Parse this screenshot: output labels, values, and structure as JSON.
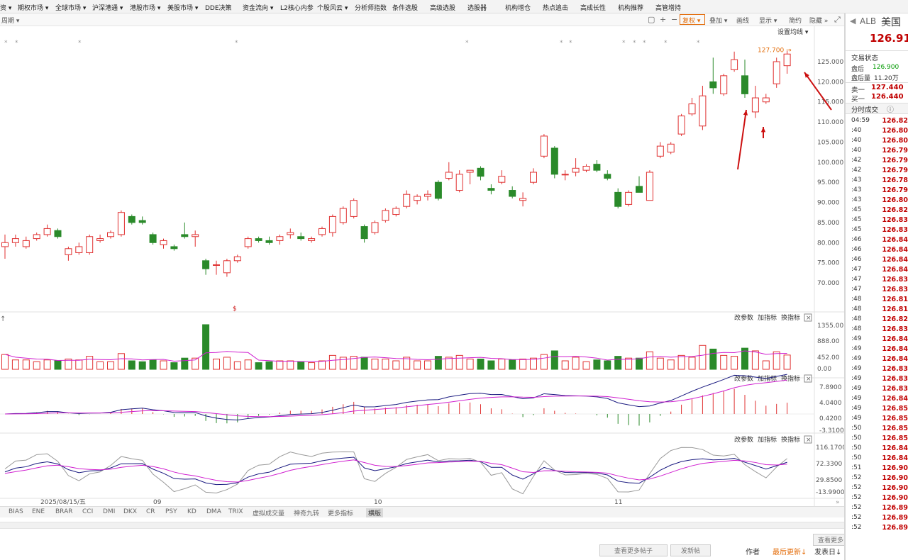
{
  "top_nav": [
    "资 ▾",
    "期权市场 ▾",
    "全球市场 ▾",
    "沪深港通 ▾",
    "港股市场 ▾",
    "美股市场 ▾",
    "DDE决策",
    "资金流向 ▾",
    "L2核心内参",
    "个股风云 ▾",
    "分析师指数",
    "条件选股",
    "高级选股",
    "选股器",
    "机构增仓",
    "热点追击",
    "高成长性",
    "机构推荐",
    "高管增持"
  ],
  "toolbar": {
    "period": "周期 ▾",
    "icons": [
      "□",
      "+",
      "−"
    ],
    "fuquan": "复权 ▾",
    "overlay": "叠加 ▾",
    "draw": "画线",
    "display": "显示 ▾",
    "simple": "简约",
    "hide": "隐藏 »",
    "ma_setting": "设置均线 ▾"
  },
  "panel_buttons": [
    "改参数",
    "加指标",
    "换指标"
  ],
  "symbol": {
    "code": "ALB",
    "market": "美国",
    "price": "126.910"
  },
  "trade_status": {
    "title": "交易状态",
    "after_label": "盘后",
    "after_value": "126.900",
    "after_vol_label": "盘后量",
    "after_vol_value": "11.20万",
    "ask_label": "卖一",
    "ask_value": "127.440",
    "bid_label": "买一",
    "bid_value": "126.440"
  },
  "tick_title": "分时成交",
  "ticks": [
    {
      "t": "04:59",
      "p": "126.82"
    },
    {
      "t": ":40",
      "p": "126.80"
    },
    {
      "t": ":40",
      "p": "126.80"
    },
    {
      "t": ":40",
      "p": "126.79"
    },
    {
      "t": ":42",
      "p": "126.79"
    },
    {
      "t": ":42",
      "p": "126.79"
    },
    {
      "t": ":43",
      "p": "126.78"
    },
    {
      "t": ":43",
      "p": "126.79"
    },
    {
      "t": ":43",
      "p": "126.80"
    },
    {
      "t": ":45",
      "p": "126.82"
    },
    {
      "t": ":45",
      "p": "126.83"
    },
    {
      "t": ":45",
      "p": "126.83"
    },
    {
      "t": ":46",
      "p": "126.84"
    },
    {
      "t": ":46",
      "p": "126.84"
    },
    {
      "t": ":46",
      "p": "126.84"
    },
    {
      "t": ":47",
      "p": "126.84"
    },
    {
      "t": ":47",
      "p": "126.83"
    },
    {
      "t": ":47",
      "p": "126.83"
    },
    {
      "t": ":48",
      "p": "126.81"
    },
    {
      "t": ":48",
      "p": "126.81"
    },
    {
      "t": ":48",
      "p": "126.82"
    },
    {
      "t": ":48",
      "p": "126.83"
    },
    {
      "t": ":49",
      "p": "126.84"
    },
    {
      "t": ":49",
      "p": "126.84"
    },
    {
      "t": ":49",
      "p": "126.84"
    },
    {
      "t": ":49",
      "p": "126.83"
    },
    {
      "t": ":49",
      "p": "126.83"
    },
    {
      "t": ":49",
      "p": "126.83"
    },
    {
      "t": ":49",
      "p": "126.84"
    },
    {
      "t": ":49",
      "p": "126.85"
    },
    {
      "t": ":49",
      "p": "126.85"
    },
    {
      "t": ":50",
      "p": "126.85"
    },
    {
      "t": ":50",
      "p": "126.85"
    },
    {
      "t": ":50",
      "p": "126.84"
    },
    {
      "t": ":50",
      "p": "126.84"
    },
    {
      "t": ":51",
      "p": "126.90"
    },
    {
      "t": ":52",
      "p": "126.90"
    },
    {
      "t": ":52",
      "p": "126.90"
    },
    {
      "t": ":52",
      "p": "126.90"
    },
    {
      "t": ":52",
      "p": "126.89"
    },
    {
      "t": ":52",
      "p": "126.89"
    },
    {
      "t": ":52",
      "p": "126.89"
    }
  ],
  "bottom_tabs": [
    "BIAS",
    "ENE",
    "BRAR",
    "CCI",
    "DMI",
    "DKX",
    "CR",
    "PSY",
    "KD",
    "DMA",
    "TRIX",
    "虚拟成交量",
    "神奇九转",
    "更多指标",
    "横版"
  ],
  "footer": {
    "more": "查看更多",
    "view_posts": "查看更多帖子",
    "post": "发新帖",
    "author": "作者",
    "latest": "最后更新↓",
    "time": "发表日↓"
  },
  "chart_data": {
    "type": "candlestick",
    "price_axis": {
      "ticks": [
        "125.000",
        "120.000",
        "115.000",
        "110.000",
        "105.000",
        "100.000",
        "95.000",
        "90.000",
        "85.000",
        "80.000",
        "75.000",
        "70.000"
      ],
      "ylim": [
        65,
        130
      ]
    },
    "date_labels": [
      "2025/08/15/五",
      "09",
      "10",
      "11"
    ],
    "max_label": "127.700",
    "candles": [
      {
        "o": 79.0,
        "h": 82.0,
        "l": 76.0,
        "c": 80.0
      },
      {
        "o": 80.0,
        "h": 82.0,
        "l": 79.0,
        "c": 81.0
      },
      {
        "o": 79.0,
        "h": 81.5,
        "l": 78.5,
        "c": 80.5
      },
      {
        "o": 81.0,
        "h": 82.5,
        "l": 80.5,
        "c": 82.0
      },
      {
        "o": 82.0,
        "h": 84.5,
        "l": 81.5,
        "c": 83.5
      },
      {
        "o": 83.0,
        "h": 83.5,
        "l": 81.0,
        "c": 81.5
      },
      {
        "o": 77.0,
        "h": 79.0,
        "l": 75.5,
        "c": 78.5
      },
      {
        "o": 77.5,
        "h": 80.0,
        "l": 77.0,
        "c": 79.0
      },
      {
        "o": 77.5,
        "h": 82.0,
        "l": 77.0,
        "c": 81.5
      },
      {
        "o": 80.5,
        "h": 82.0,
        "l": 80.0,
        "c": 81.0
      },
      {
        "o": 81.5,
        "h": 83.0,
        "l": 81.0,
        "c": 82.5
      },
      {
        "o": 82.0,
        "h": 88.0,
        "l": 81.5,
        "c": 87.5
      },
      {
        "o": 86.5,
        "h": 87.0,
        "l": 84.5,
        "c": 85.0
      },
      {
        "o": 85.5,
        "h": 86.5,
        "l": 84.5,
        "c": 85.0
      },
      {
        "o": 82.0,
        "h": 82.5,
        "l": 79.5,
        "c": 80.0
      },
      {
        "o": 79.5,
        "h": 81.0,
        "l": 78.5,
        "c": 80.5
      },
      {
        "o": 79.0,
        "h": 79.5,
        "l": 78.0,
        "c": 78.5
      },
      {
        "o": 82.0,
        "h": 85.0,
        "l": 81.0,
        "c": 81.5
      },
      {
        "o": 81.5,
        "h": 83.0,
        "l": 79.0,
        "c": 82.0
      },
      {
        "o": 75.5,
        "h": 76.0,
        "l": 72.0,
        "c": 73.5
      },
      {
        "o": 74.5,
        "h": 75.5,
        "l": 72.0,
        "c": 74.5
      },
      {
        "o": 72.5,
        "h": 76.0,
        "l": 71.5,
        "c": 75.5
      },
      {
        "o": 75.5,
        "h": 77.0,
        "l": 75.0,
        "c": 76.5
      },
      {
        "o": 79.0,
        "h": 81.5,
        "l": 78.5,
        "c": 81.0
      },
      {
        "o": 81.0,
        "h": 81.5,
        "l": 80.0,
        "c": 80.5
      },
      {
        "o": 80.5,
        "h": 81.5,
        "l": 79.5,
        "c": 80.0
      },
      {
        "o": 80.5,
        "h": 82.0,
        "l": 79.5,
        "c": 81.5
      },
      {
        "o": 82.0,
        "h": 83.5,
        "l": 81.0,
        "c": 82.5
      },
      {
        "o": 81.5,
        "h": 82.5,
        "l": 80.5,
        "c": 81.0
      },
      {
        "o": 80.5,
        "h": 81.5,
        "l": 80.0,
        "c": 81.0
      },
      {
        "o": 82.0,
        "h": 84.0,
        "l": 81.5,
        "c": 83.5
      },
      {
        "o": 82.5,
        "h": 87.0,
        "l": 81.5,
        "c": 86.5
      },
      {
        "o": 85.0,
        "h": 89.0,
        "l": 84.5,
        "c": 88.5
      },
      {
        "o": 86.5,
        "h": 91.0,
        "l": 86.0,
        "c": 90.5
      },
      {
        "o": 84.0,
        "h": 84.5,
        "l": 80.0,
        "c": 81.0
      },
      {
        "o": 82.5,
        "h": 85.5,
        "l": 82.0,
        "c": 85.0
      },
      {
        "o": 85.5,
        "h": 88.5,
        "l": 85.0,
        "c": 88.0
      },
      {
        "o": 87.0,
        "h": 89.0,
        "l": 86.5,
        "c": 88.5
      },
      {
        "o": 89.0,
        "h": 93.0,
        "l": 88.5,
        "c": 92.0
      },
      {
        "o": 90.5,
        "h": 92.0,
        "l": 89.5,
        "c": 91.5
      },
      {
        "o": 91.5,
        "h": 93.0,
        "l": 90.5,
        "c": 92.0
      },
      {
        "o": 95.0,
        "h": 95.5,
        "l": 90.5,
        "c": 91.0
      },
      {
        "o": 96.0,
        "h": 100.0,
        "l": 95.5,
        "c": 97.5
      },
      {
        "o": 93.0,
        "h": 98.0,
        "l": 92.5,
        "c": 97.0
      },
      {
        "o": 97.5,
        "h": 98.0,
        "l": 94.5,
        "c": 98.0
      },
      {
        "o": 98.5,
        "h": 99.0,
        "l": 95.5,
        "c": 96.5
      },
      {
        "o": 93.5,
        "h": 94.5,
        "l": 92.0,
        "c": 93.0
      },
      {
        "o": 95.0,
        "h": 98.0,
        "l": 94.5,
        "c": 96.5
      },
      {
        "o": 93.0,
        "h": 94.0,
        "l": 91.0,
        "c": 91.5
      },
      {
        "o": 90.5,
        "h": 92.5,
        "l": 89.0,
        "c": 91.0
      },
      {
        "o": 95.0,
        "h": 98.5,
        "l": 94.5,
        "c": 97.5
      },
      {
        "o": 101.5,
        "h": 107.0,
        "l": 101.0,
        "c": 106.5
      },
      {
        "o": 103.5,
        "h": 104.0,
        "l": 96.0,
        "c": 97.0
      },
      {
        "o": 97.0,
        "h": 98.0,
        "l": 95.5,
        "c": 97.0
      },
      {
        "o": 97.5,
        "h": 101.0,
        "l": 96.5,
        "c": 98.5
      },
      {
        "o": 98.0,
        "h": 99.5,
        "l": 97.5,
        "c": 99.0
      },
      {
        "o": 99.5,
        "h": 100.5,
        "l": 97.5,
        "c": 98.0
      },
      {
        "o": 97.0,
        "h": 98.0,
        "l": 95.5,
        "c": 96.0
      },
      {
        "o": 92.5,
        "h": 93.5,
        "l": 88.5,
        "c": 89.0
      },
      {
        "o": 89.5,
        "h": 93.0,
        "l": 89.0,
        "c": 92.5
      },
      {
        "o": 94.0,
        "h": 96.5,
        "l": 92.5,
        "c": 92.5
      },
      {
        "o": 90.5,
        "h": 98.0,
        "l": 90.5,
        "c": 97.5
      },
      {
        "o": 101.5,
        "h": 105.0,
        "l": 101.0,
        "c": 104.0
      },
      {
        "o": 102.5,
        "h": 105.0,
        "l": 102.0,
        "c": 104.5
      },
      {
        "o": 107.0,
        "h": 112.0,
        "l": 106.5,
        "c": 111.5
      },
      {
        "o": 112.0,
        "h": 116.0,
        "l": 111.5,
        "c": 114.5
      },
      {
        "o": 109.0,
        "h": 119.0,
        "l": 108.0,
        "c": 116.5
      },
      {
        "o": 120.0,
        "h": 126.0,
        "l": 117.0,
        "c": 118.5
      },
      {
        "o": 117.0,
        "h": 122.0,
        "l": 116.5,
        "c": 121.5
      },
      {
        "o": 123.0,
        "h": 127.5,
        "l": 122.5,
        "c": 125.5
      },
      {
        "o": 121.5,
        "h": 125.5,
        "l": 116.0,
        "c": 117.0
      },
      {
        "o": 112.5,
        "h": 119.0,
        "l": 111.0,
        "c": 116.0
      },
      {
        "o": 115.0,
        "h": 117.0,
        "l": 114.5,
        "c": 116.0
      },
      {
        "o": 119.5,
        "h": 126.0,
        "l": 118.5,
        "c": 125.0
      },
      {
        "o": 124.0,
        "h": 127.7,
        "l": 122.0,
        "c": 126.9
      }
    ],
    "volume_axis": [
      "1355.00",
      "888.00",
      "452.00",
      "0.00"
    ],
    "macd_axis": [
      "7.8900",
      "4.0400",
      "0.4200",
      "-3.3100"
    ],
    "osc_axis": [
      "116.1700",
      "72.3300",
      "29.8500",
      "-13.9900"
    ]
  }
}
